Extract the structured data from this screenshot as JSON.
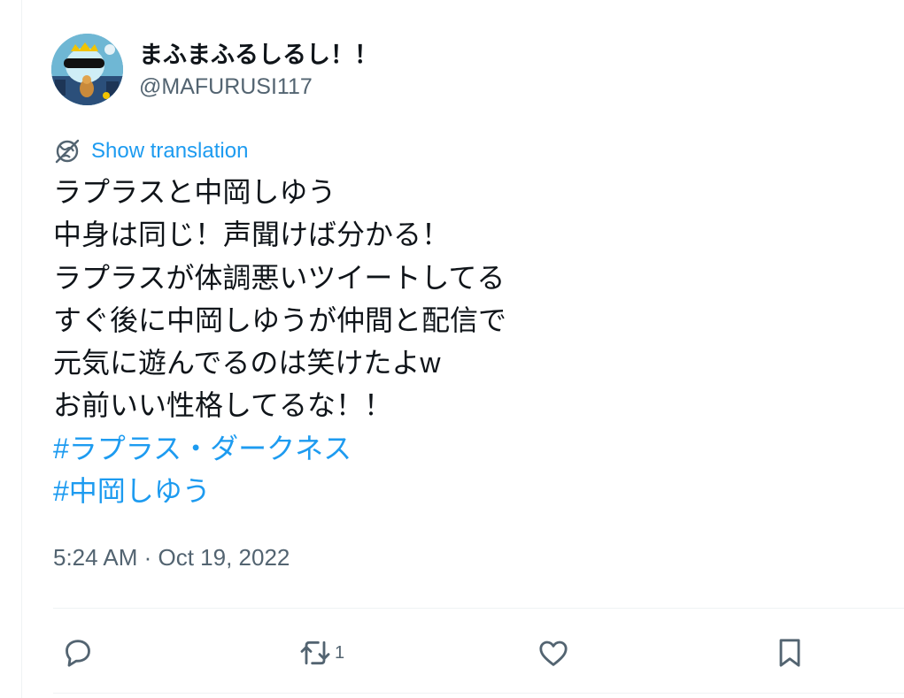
{
  "tweet": {
    "display_name": "まふまふるしるし！！",
    "handle": "@MAFURUSI117",
    "translate_label": "Show translation",
    "lines": [
      "ラプラスと中岡しゆう",
      "中身は同じ！声聞けば分かる！",
      "ラプラスが体調悪いツイートしてる",
      "すぐ後に中岡しゆうが仲間と配信で",
      "元気に遊んでるのは笑けたよw",
      "お前いい性格してるな！！"
    ],
    "hashtags": [
      "#ラプラス・ダークネス",
      "#中岡しゆう"
    ],
    "timestamp": "5:24 AM · Oct 19, 2022"
  },
  "actions": {
    "reply_icon": "reply-icon",
    "retweet_icon": "retweet-icon",
    "retweet_count": "1",
    "like_icon": "like-icon",
    "bookmark_icon": "bookmark-icon"
  },
  "colors": {
    "link": "#1d9bf0",
    "secondary_text": "#536471",
    "primary_text": "#0f1419",
    "divider": "#eff3f4"
  }
}
